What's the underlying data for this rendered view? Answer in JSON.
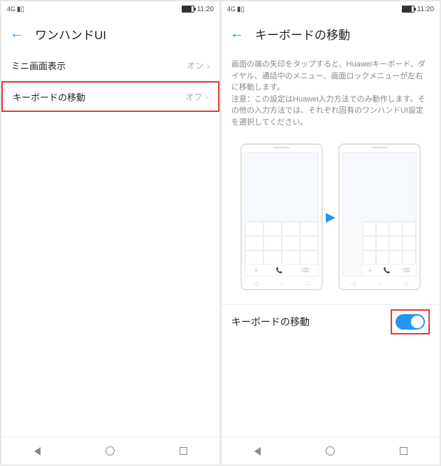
{
  "status": {
    "signal": "4G",
    "time": "11:20"
  },
  "left": {
    "title": "ワンハンドUI",
    "rows": [
      {
        "label": "ミニ画面表示",
        "value": "オン"
      },
      {
        "label": "キーボードの移動",
        "value": "オフ"
      }
    ]
  },
  "right": {
    "title": "キーボードの移動",
    "description": "画面の端の矢印をタップすると、Huaweiキーボード、ダイヤル、通話中のメニュー、画面ロックメニューが左右に移動します。\n注意：この設定はHuawei入力方法でのみ動作します。その他の入力方法では、それぞれ固有のワンハンドUI設定を選択してください。",
    "toggle": {
      "label": "キーボードの移動",
      "state": "on"
    }
  }
}
